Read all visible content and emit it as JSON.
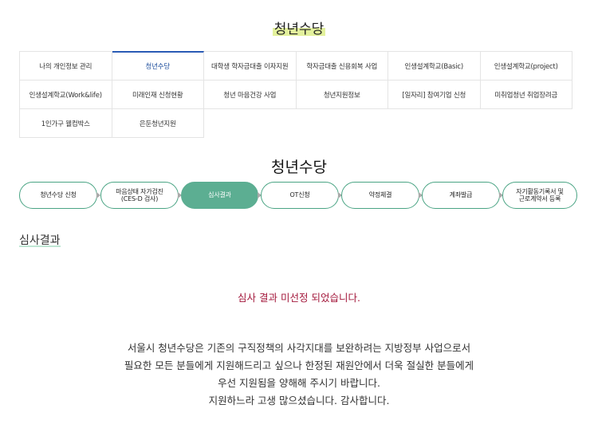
{
  "page": {
    "title": "청년수당"
  },
  "menu": {
    "items": [
      {
        "label": "나의 개인정보 관리",
        "active": false
      },
      {
        "label": "청년수당",
        "active": true
      },
      {
        "label": "대학생 학자금대출 이자지원",
        "active": false
      },
      {
        "label": "학자금대출 신용회복 사업",
        "active": false
      },
      {
        "label": "인생설계학교(Basic)",
        "active": false
      },
      {
        "label": "인생설계학교(project)",
        "active": false
      },
      {
        "label": "인생설계학교(Work&life)",
        "active": false
      },
      {
        "label": "미래인재 신청현황",
        "active": false
      },
      {
        "label": "청년 마음건강 사업",
        "active": false
      },
      {
        "label": "청년지원정보",
        "active": false
      },
      {
        "label": "[일자리] 참여기업 신청",
        "active": false
      },
      {
        "label": "미취업청년 취업장려금",
        "active": false
      },
      {
        "label": "1인가구 웰컴박스",
        "active": false
      },
      {
        "label": "은둔청년지원",
        "active": false
      }
    ]
  },
  "section": {
    "title": "청년수당"
  },
  "steps": {
    "items": [
      {
        "line1": "청년수당 신청",
        "line2": "",
        "active": false
      },
      {
        "line1": "마음상태 자가검진",
        "line2": "(CES-D 검사)",
        "active": false
      },
      {
        "line1": "심사결과",
        "line2": "",
        "active": true
      },
      {
        "line1": "OT신청",
        "line2": "",
        "active": false
      },
      {
        "line1": "약정체결",
        "line2": "",
        "active": false
      },
      {
        "line1": "계좌발급",
        "line2": "",
        "active": false
      },
      {
        "line1": "자기활동기록서 및",
        "line2": "근로계약서 등록",
        "active": false
      }
    ]
  },
  "result": {
    "heading": "심사결과",
    "message": "심사 결과 미선정 되었습니다.",
    "description": [
      "서울시 청년수당은 기존의 구직정책의 사각지대를 보완하려는 지방정부 사업으로서",
      "필요한 모든 분들에게 지원해드리고 싶으나 한정된 재원안에서 더욱 절실한 분들에게",
      "우선 지원됨을 양해해 주시기 바랍니다.",
      "지원하느라 고생 많으셨습니다. 감사합니다."
    ]
  },
  "colors": {
    "accent_green": "#5cae92",
    "active_blue": "#2a5bb5",
    "error_red": "#a3173b",
    "highlight_yellow": "#e3f19c"
  }
}
